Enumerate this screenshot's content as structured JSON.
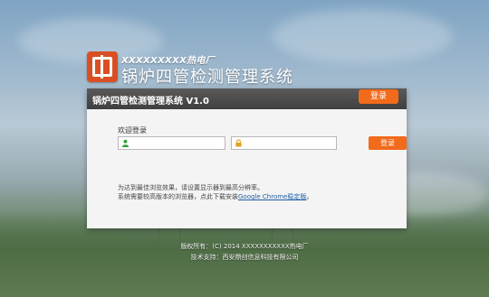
{
  "brand": {
    "org": "XXXXXXXXX热电厂",
    "system_name": "锅炉四管检测管理系统"
  },
  "panel": {
    "title": "锅炉四管检测管理系统 V1.0",
    "tab_label": "登录",
    "welcome": "欢迎登录",
    "username_placeholder": "",
    "password_placeholder": "",
    "login_button": "登录",
    "notice_line1": "为达到最佳浏览效果，请设置显示器到最高分辨率。",
    "notice_line2_prefix": "系统需要较高版本的浏览器，点此下载安装",
    "notice_link": "Google Chrome稳定版",
    "notice_line2_suffix": "。"
  },
  "footer": {
    "copyright": "版权所有：(C) 2014 XXXXXXXXXXX热电厂",
    "support": "技术支持：西安鼎创信息科技有限公司"
  },
  "colors": {
    "accent": "#f26a1b",
    "header_dark": "#454545",
    "user_icon": "#33a23c",
    "lock_icon": "#e5a21a",
    "link": "#1e5ea8"
  },
  "icons": [
    "logo-icon",
    "user-icon",
    "lock-icon"
  ]
}
